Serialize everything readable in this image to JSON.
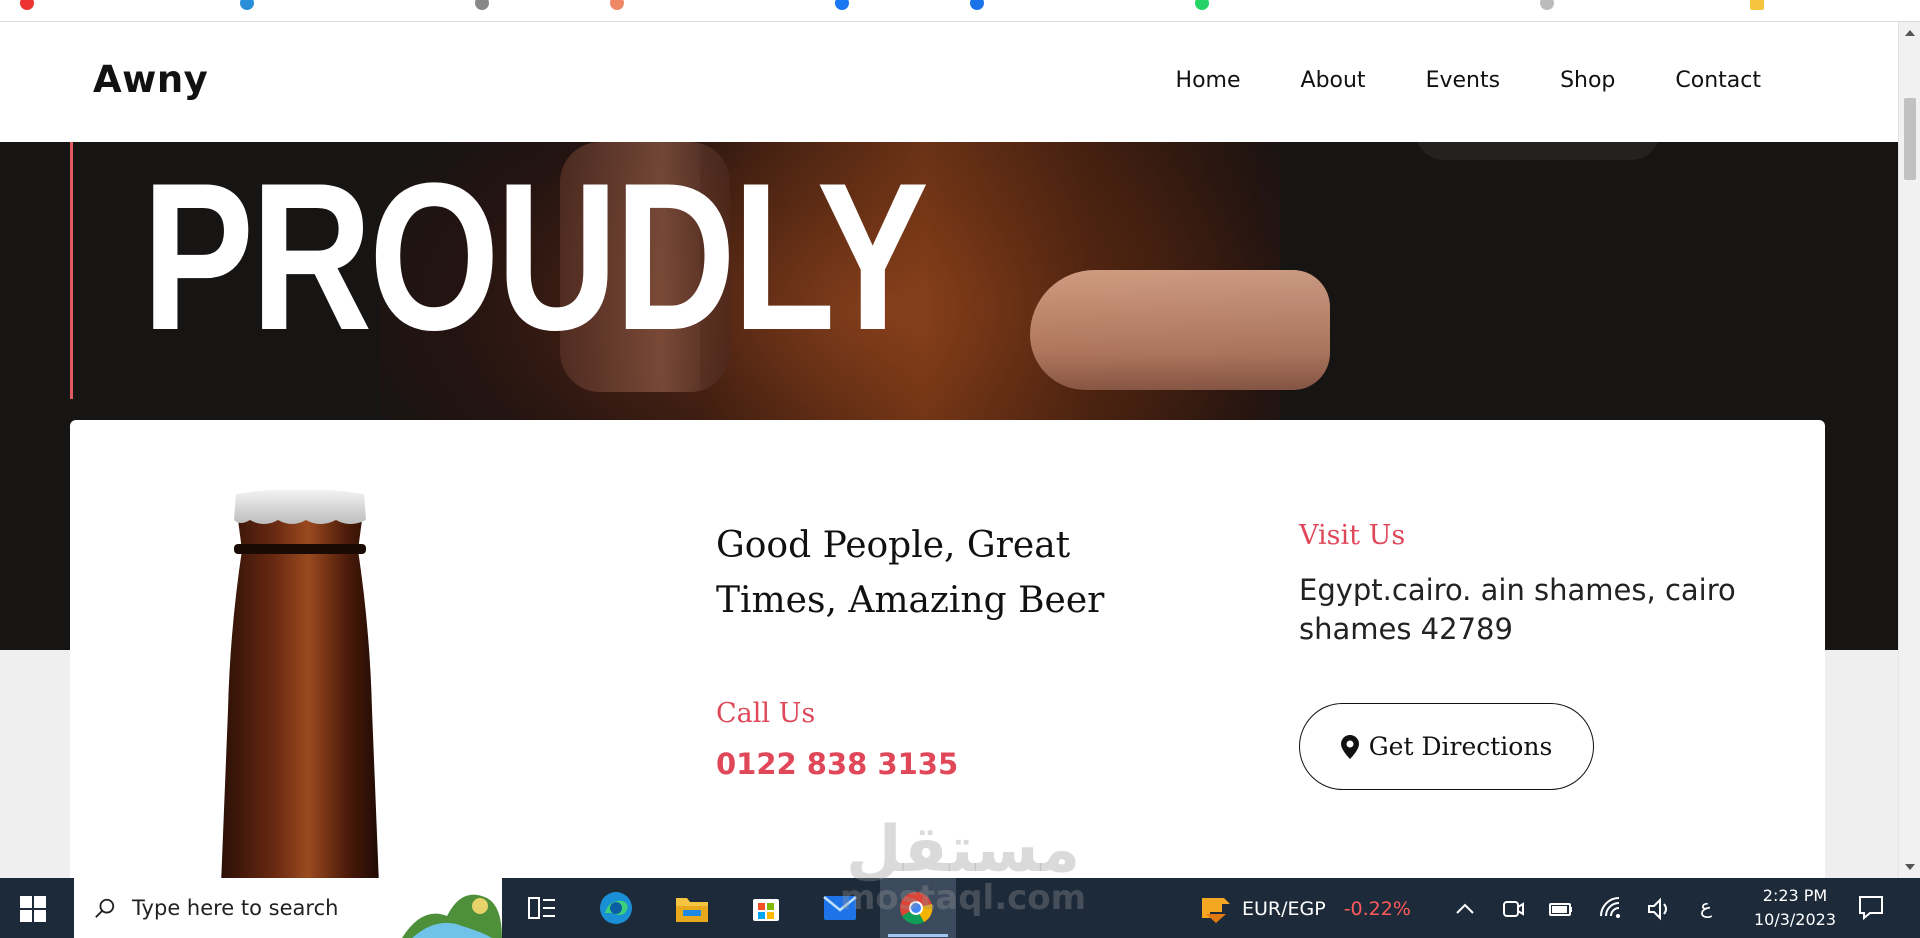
{
  "site": {
    "logo": "Awny",
    "nav": [
      "Home",
      "About",
      "Events",
      "Shop",
      "Contact"
    ]
  },
  "hero": {
    "title": "PROUDLY"
  },
  "info": {
    "tagline": "Good People, Great Times, Amazing Beer",
    "call_label": "Call Us",
    "phone": "0122 838 3135",
    "visit_label": "Visit Us",
    "address": "Egypt.cairo. ain shames, cairo shames 42789",
    "directions_label": "Get Directions"
  },
  "watermark": {
    "arabic": "مستقل",
    "latin": "mostaql.com"
  },
  "taskbar": {
    "search_placeholder": "Type here to search",
    "ticker_pair": "EUR/EGP",
    "ticker_change": "-0.22%",
    "language": "ع",
    "time": "2:23 PM",
    "date": "10/3/2023"
  },
  "colors": {
    "accent": "#e0485a",
    "hero_bg": "#171414",
    "taskbar_bg": "#1c2a3a"
  }
}
